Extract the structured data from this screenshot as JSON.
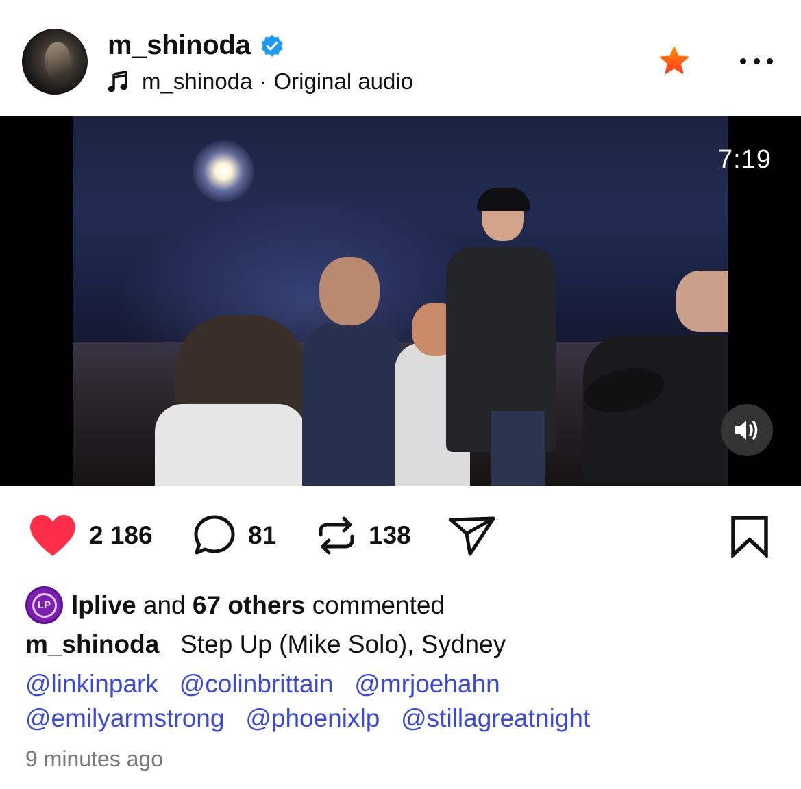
{
  "post": {
    "author": "m_shinoda",
    "audio_author": "m_shinoda",
    "audio_separator": "·",
    "audio_label": "Original audio",
    "colors": {
      "verified": "#1d9bf0",
      "star": "#ff4d1a",
      "like": "#ff2d48",
      "mention": "#3b4ad6"
    }
  },
  "video": {
    "duration": "7:19",
    "sound_icon": "speaker-icon"
  },
  "actions": {
    "likes": "2 186",
    "comments": "81",
    "reposts": "138"
  },
  "caption": {
    "commenter": "lplive",
    "commenter_avatar_text": "LP",
    "and_text": "and",
    "others": "67 others",
    "commented_text": "commented",
    "author": "m_shinoda",
    "text": "Step Up (Mike Solo), Sydney",
    "mentions_line1": [
      "@linkinpark",
      "@colinbrittain",
      "@mrjoehahn"
    ],
    "mentions_line2": [
      "@emilyarmstrong",
      "@phoenixlp",
      "@stillagreatnight"
    ],
    "timestamp": "9 minutes ago"
  }
}
